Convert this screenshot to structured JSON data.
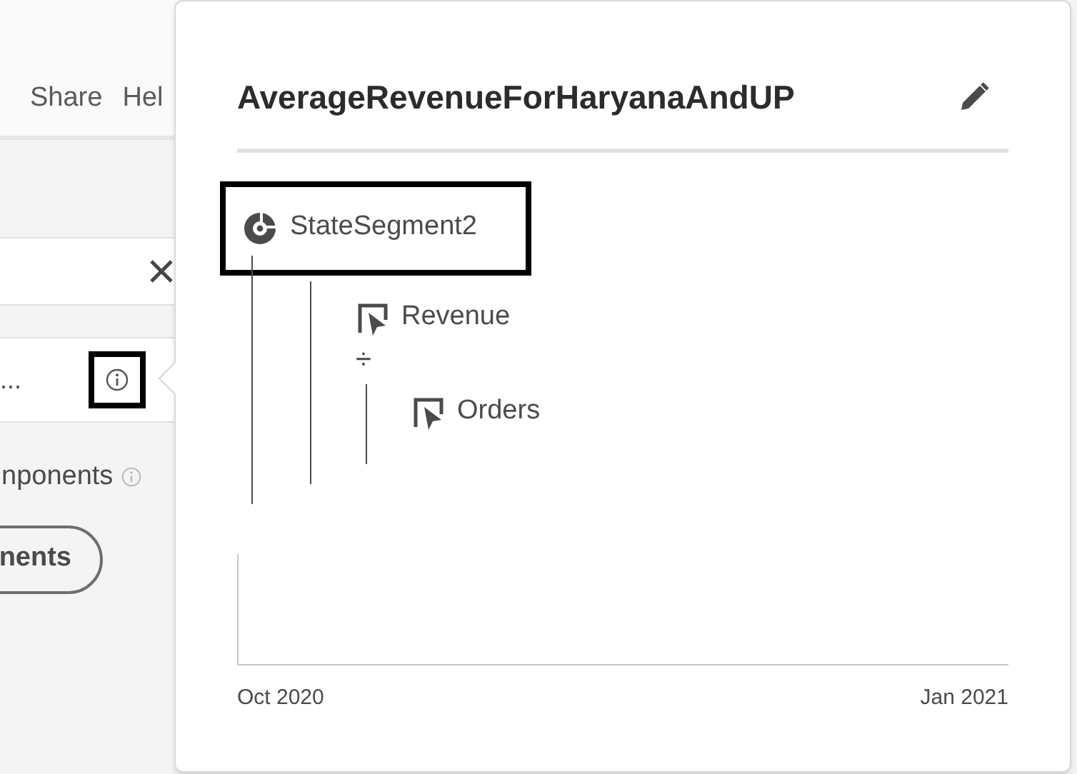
{
  "background": {
    "header_links": [
      "Share",
      "Hel"
    ],
    "component_row": {
      "label": "..."
    },
    "section_label": "nponents",
    "button": "nents"
  },
  "popover": {
    "title": "AverageRevenueForHaryanaAndUP",
    "definition": {
      "kind": "segment",
      "label": "StateSegment2",
      "highlighted": true,
      "children": [
        {
          "kind": "metric",
          "label": "Revenue"
        },
        {
          "kind": "operator",
          "label": "÷",
          "children": [
            {
              "kind": "metric",
              "label": "Orders"
            }
          ]
        }
      ]
    },
    "chart": {
      "x_labels": [
        "Oct 2020",
        "Jan 2021"
      ]
    }
  }
}
